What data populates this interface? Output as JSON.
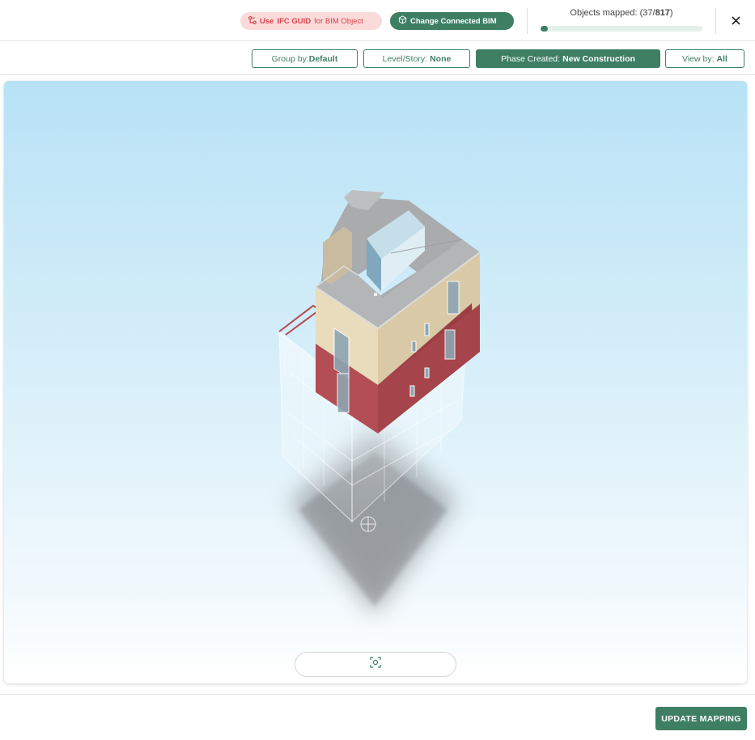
{
  "header": {
    "ifc_prefix": "Use",
    "ifc_highlight": "IFC GUID",
    "ifc_suffix": "for BIM Object",
    "change_bim_label": "Change Connected BIM",
    "mapped_label": "Objects mapped: (37/",
    "mapped_total": "817",
    "mapped_close": ")",
    "mapped_count": 37,
    "mapped_of": 817,
    "accent": "#3e7f63",
    "danger": "#d9434a"
  },
  "filters": {
    "group_label": "Group by:",
    "group_value": "Default",
    "level_label": "Level/Story:",
    "level_value": "None",
    "phase_label": "Phase Created:",
    "phase_value": "New Construction",
    "view_label": "View by:",
    "view_value": "All"
  },
  "icons": {
    "ifc": "link-nodes-icon",
    "bim": "cube-icon",
    "close": "close-icon",
    "fit": "focus-target-icon"
  },
  "footer": {
    "update_label": "UPDATE MAPPING"
  }
}
